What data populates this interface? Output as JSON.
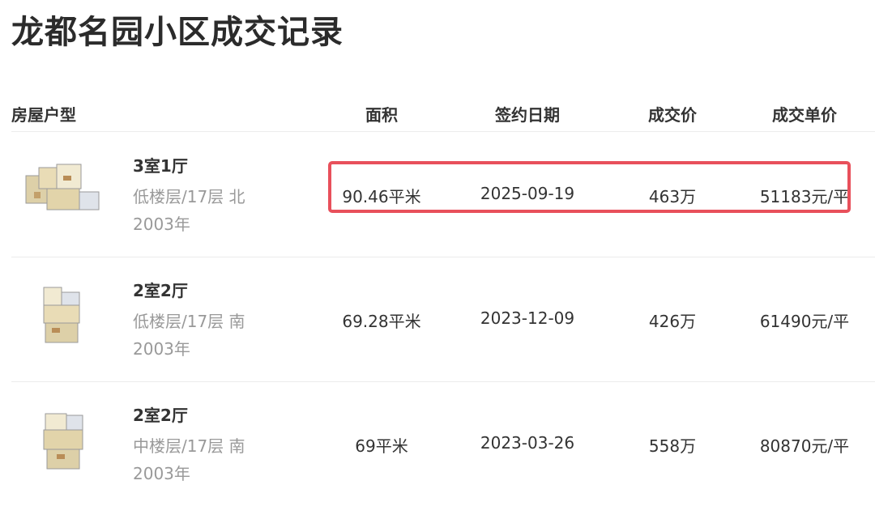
{
  "page": {
    "title": "龙都名园小区成交记录"
  },
  "table": {
    "headers": {
      "type": "房屋户型",
      "area": "面积",
      "date": "签约日期",
      "price": "成交价",
      "unit_price": "成交单价"
    },
    "rows": [
      {
        "layout": "3室1厅",
        "floor_orientation": "低楼层/17层 北",
        "year": "2003年",
        "area": "90.46平米",
        "date": "2025-09-19",
        "price": "463万",
        "unit_price": "51183元/平",
        "highlighted": true
      },
      {
        "layout": "2室2厅",
        "floor_orientation": "低楼层/17层 南",
        "year": "2003年",
        "area": "69.28平米",
        "date": "2023-12-09",
        "price": "426万",
        "unit_price": "61490元/平",
        "highlighted": false
      },
      {
        "layout": "2室2厅",
        "floor_orientation": "中楼层/17层 南",
        "year": "2003年",
        "area": "69平米",
        "date": "2023-03-26",
        "price": "558万",
        "unit_price": "80870元/平",
        "highlighted": false
      }
    ]
  },
  "colors": {
    "highlight_border": "#e8505b",
    "primary_text": "#333333",
    "secondary_text": "#999999"
  }
}
